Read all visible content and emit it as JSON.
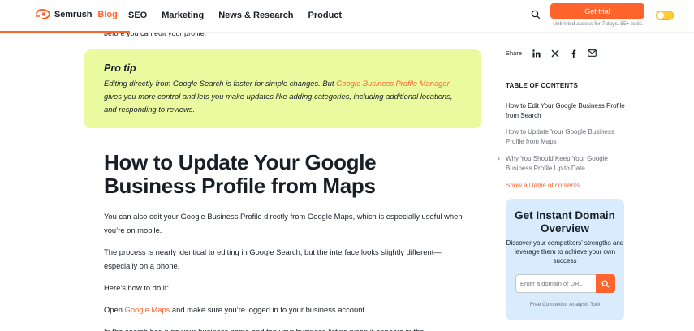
{
  "header": {
    "logo_text": "Semrush",
    "logo_sub": "Blog",
    "nav": [
      "SEO",
      "Marketing",
      "News & Research",
      "Product"
    ],
    "trial_label": "Get trial",
    "trial_sub": "Unlimited access for 7 days. 55+ tools."
  },
  "article": {
    "cut_text": "before you can edit your profile.",
    "pro_tip": {
      "title": "Pro tip",
      "text_before": "Editing directly from Google Search is faster for simple changes. But ",
      "link": "Google Business Profile Manager",
      "text_after": " gives you more control and lets you make updates like adding categories, including additional locations, and responding to reviews."
    },
    "heading": "How to Update Your Google Business Profile from Maps",
    "p1": "You can also edit your Google Business Profile directly from Google Maps, which is especially useful when you’re on mobile.",
    "p2": "The process is nearly identical to editing in Google Search, but the interface looks slightly different—especially on a phone.",
    "p3": "Here’s how to do it:",
    "p4_before": "Open ",
    "p4_link": "Google Maps",
    "p4_after": " and make sure you’re logged in to your business account.",
    "p5": "In the search bar, type your business name and tap your business listing when it appears in the"
  },
  "sidebar": {
    "share_label": "Share",
    "toc_title": "TABLE OF CONTENTS",
    "toc": [
      "How to Edit Your Google Business Profile from Search",
      "How to Update Your Google Business Profile from Maps",
      "Why You Should Keep Your Google Business Profile Up to Date"
    ],
    "toc_all": "Show all table of contents",
    "promo": {
      "title": "Get Instant Domain Overview",
      "desc": "Discover your competitors’ strengths and leverage them to achieve your own success",
      "placeholder": "Enter a domain or URL",
      "foot": "Free Competitor Analysis Tool"
    }
  },
  "colors": {
    "accent": "#ff642d",
    "pro_tip_bg": "#ebfa9e",
    "promo_bg": "#d8ecfe",
    "toggle": "#ffcc33"
  }
}
